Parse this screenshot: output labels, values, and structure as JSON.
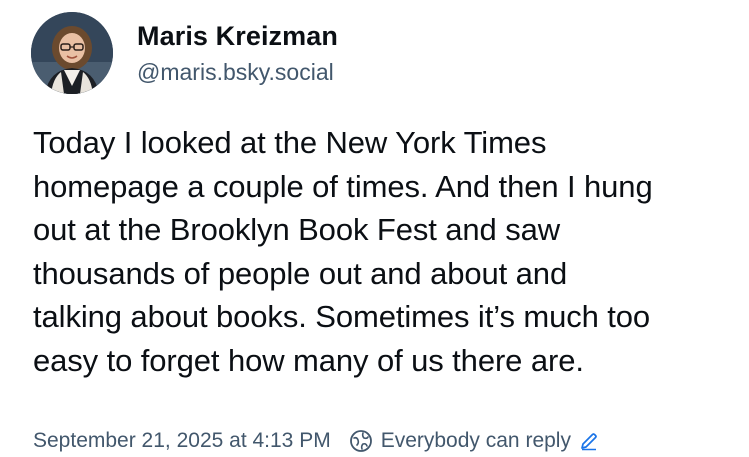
{
  "author": {
    "display_name": "Maris Kreizman",
    "handle": "@maris.bsky.social",
    "avatar_icon": "user-avatar"
  },
  "post": {
    "text": "Today I looked at the New York Times\nhomepage a couple of times. And then I hung\nout at the Brooklyn Book Fest and saw\nthousands of people out and about and\ntalking about books. Sometimes it’s much too\neasy to forget how many of us there are."
  },
  "meta": {
    "timestamp": "September 21, 2025 at 4:13 PM",
    "reply_setting": "Everybody can reply",
    "reply_icon": "globe-icon",
    "edit_icon": "pencil-icon"
  },
  "colors": {
    "text": "#0b0f14",
    "muted": "#42576c",
    "background": "#ffffff"
  }
}
